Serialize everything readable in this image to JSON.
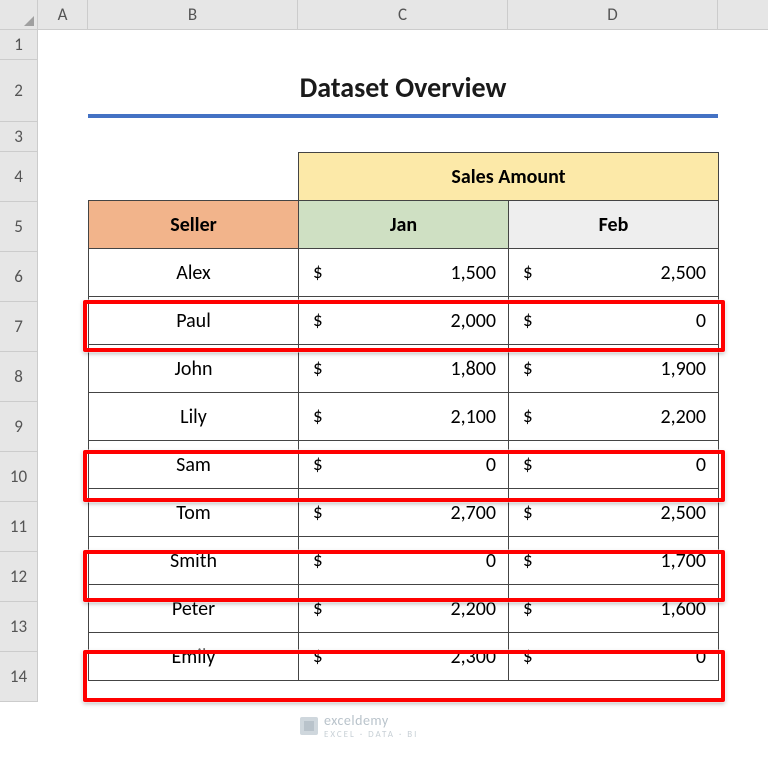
{
  "columns": {
    "A": "A",
    "B": "B",
    "C": "C",
    "D": "D"
  },
  "rows": [
    "1",
    "2",
    "3",
    "4",
    "5",
    "6",
    "7",
    "8",
    "9",
    "10",
    "11",
    "12",
    "13",
    "14"
  ],
  "title": "Dataset Overview",
  "headers": {
    "sales_amount": "Sales Amount",
    "seller": "Seller",
    "jan": "Jan",
    "feb": "Feb"
  },
  "currency_symbol": "$",
  "rows_data": [
    {
      "seller": "Alex",
      "jan": "1,500",
      "feb": "2,500",
      "highlight": false
    },
    {
      "seller": "Paul",
      "jan": "2,000",
      "feb": "0",
      "highlight": true
    },
    {
      "seller": "John",
      "jan": "1,800",
      "feb": "1,900",
      "highlight": false
    },
    {
      "seller": "Lily",
      "jan": "2,100",
      "feb": "2,200",
      "highlight": false
    },
    {
      "seller": "Sam",
      "jan": "0",
      "feb": "0",
      "highlight": true
    },
    {
      "seller": "Tom",
      "jan": "2,700",
      "feb": "2,500",
      "highlight": false
    },
    {
      "seller": "Smith",
      "jan": "0",
      "feb": "1,700",
      "highlight": true
    },
    {
      "seller": "Peter",
      "jan": "2,200",
      "feb": "1,600",
      "highlight": false
    },
    {
      "seller": "Emily",
      "jan": "2,300",
      "feb": "0",
      "highlight": true
    }
  ],
  "watermark": {
    "brand": "exceldemy",
    "tagline": "EXCEL · DATA · BI"
  },
  "chart_data": {
    "type": "table",
    "title": "Dataset Overview",
    "columns": [
      "Seller",
      "Jan",
      "Feb"
    ],
    "series": [
      {
        "name": "Jan",
        "values": [
          1500,
          2000,
          1800,
          2100,
          0,
          2700,
          0,
          2200,
          2300
        ]
      },
      {
        "name": "Feb",
        "values": [
          2500,
          0,
          1900,
          2200,
          0,
          2500,
          1700,
          1600,
          0
        ]
      }
    ],
    "categories": [
      "Alex",
      "Paul",
      "John",
      "Lily",
      "Sam",
      "Tom",
      "Smith",
      "Peter",
      "Emily"
    ]
  }
}
